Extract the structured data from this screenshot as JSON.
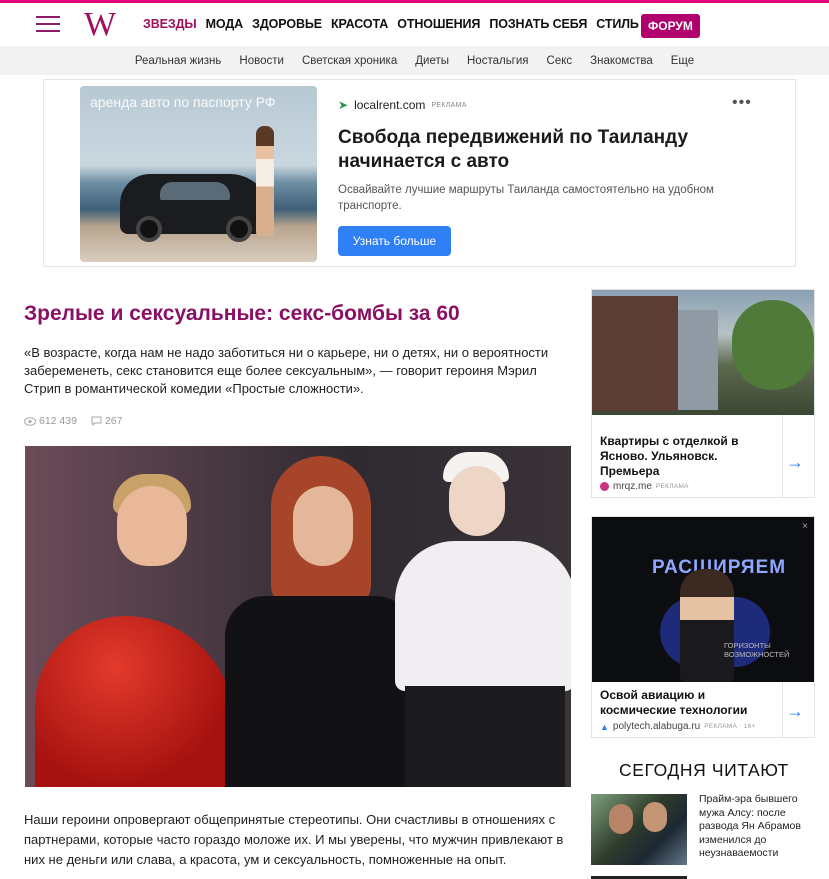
{
  "logo": "W",
  "nav": {
    "main": [
      "ЗВЕЗДЫ",
      "МОДА",
      "ЗДОРОВЬЕ",
      "КРАСОТА",
      "ОТНОШЕНИЯ",
      "ПОЗНАТЬ СЕБЯ",
      "СТИЛЬ ЖИЗНИ"
    ],
    "forum": "ФОРУМ",
    "sub": [
      "Реальная жизнь",
      "Новости",
      "Светская хроника",
      "Диеты",
      "Ностальгия",
      "Секс",
      "Знакомства",
      "Еще"
    ]
  },
  "ad_banner": {
    "image_caption": "аренда авто по паспорту РФ",
    "source": "localrent.com",
    "source_tag": "РЕКЛАМА",
    "menu": "•••",
    "title": "Свобода передвижений по Таиланду начинается с авто",
    "text": "Освайвайте лучшие маршруты Таиланда самостоятельно на удобном транспорте.",
    "button": "Узнать больше"
  },
  "article": {
    "title": "Зрелые и сексуальные: секс-бомбы за 60",
    "lead": "«В возрасте, когда нам не надо заботиться ни о карьере, ни о детях, ни о вероятности забеременеть, секс становится еще более сексуальным», — говорит героиня Мэрил Стрип в романтической комедии «Простые сложности».",
    "views": "612 439",
    "comments": "267",
    "body": "Наши героини опровергают общепринятые стереотипы. Они счастливы в отношениях с партнерами, которые часто гораздо моложе их. И мы уверены, что мужчин привлекают в них не деньги или слава, а красота, ум и сексуальность, помноженные на опыт."
  },
  "sidebar": {
    "card1": {
      "title": "Квартиры с отделкой в Ясново. Ульяновск. Премьера",
      "source": "mrqz.me",
      "tag": "РЕКЛАМА",
      "arrow": "→"
    },
    "card2": {
      "image_headline": "РАСШИРЯЕМ",
      "image_sub": "ГОРИЗОНТЫ\nВОЗМОЖНОСТЕЙ",
      "close": "×",
      "title": "Освой авиацию и космические технологии",
      "source": "polytech.alabuga.ru",
      "tag": "РЕКЛАМА · 16+",
      "arrow": "→"
    },
    "today_title": "СЕГОДНЯ ЧИТАЮТ",
    "today_item": "Прайм-эра бывшего мужа Алсу: после развода Ян Абрамов изменился до неузнаваемости"
  },
  "colors": {
    "brand": "#a0105c",
    "forum": "#b1006d",
    "ad_button": "#2f7ff5"
  }
}
